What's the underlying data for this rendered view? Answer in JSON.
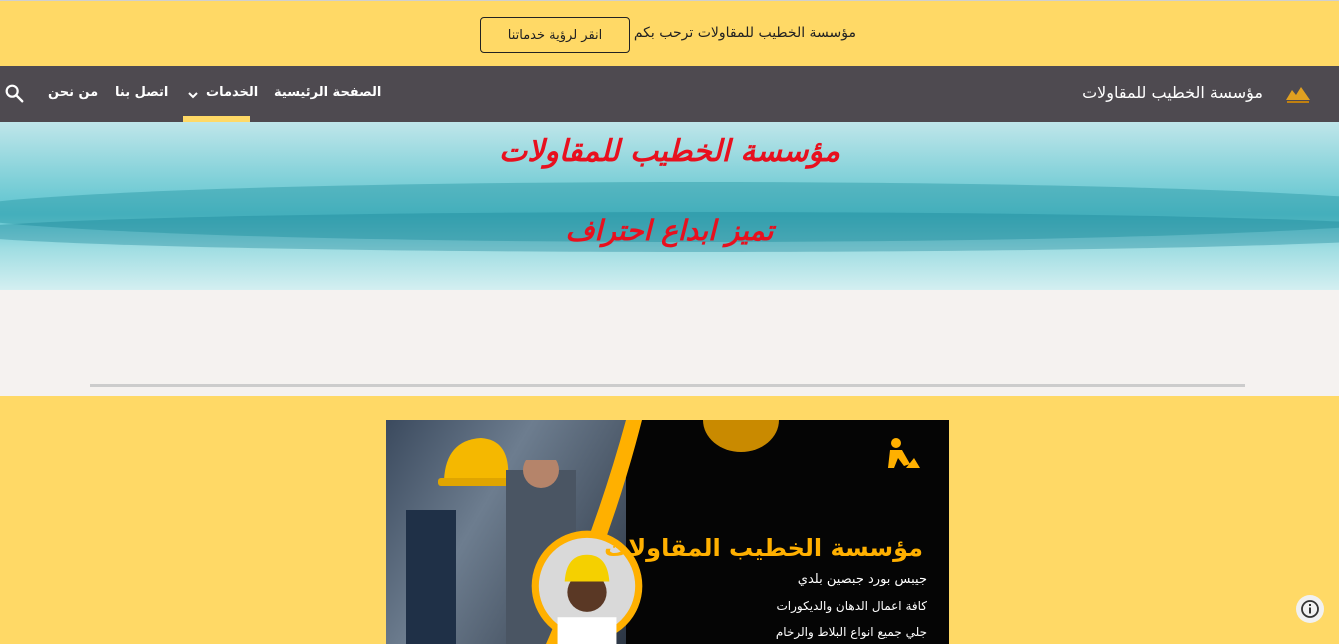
{
  "announcement": {
    "text": "مؤسسة الخطيب للمقاولات ترحب بكم",
    "button_label": "انقر لرؤية خدماتنا"
  },
  "nav": {
    "site_title": "مؤسسة الخطيب للمقاولات",
    "items": [
      {
        "label": "الصفحة الرئيسية"
      },
      {
        "label": "الخدمات"
      },
      {
        "label": "اتصل بنا"
      },
      {
        "label": "من نحن"
      }
    ],
    "active_item": "الخدمات"
  },
  "hero": {
    "line1": "مؤسسة الخطيب للمقاولات",
    "line2": "تميز ابداع احتراف"
  },
  "banner": {
    "title": "مؤسسة الخطيب المقاولات",
    "line1": "جيبس بورد جبصين بلدي",
    "line2": "كافة اعمال الدهان والديكورات",
    "line3": "جلي جميع انواع البلاط والرخام"
  },
  "colors": {
    "accent": "#ffd966",
    "nav_bg": "#4e4a50",
    "hero_text": "#e8101e",
    "banner_orange": "#ffb000"
  },
  "icons": [
    "search-icon",
    "chevron-down-icon",
    "logo-icon",
    "info-icon",
    "construction-worker-icon"
  ]
}
